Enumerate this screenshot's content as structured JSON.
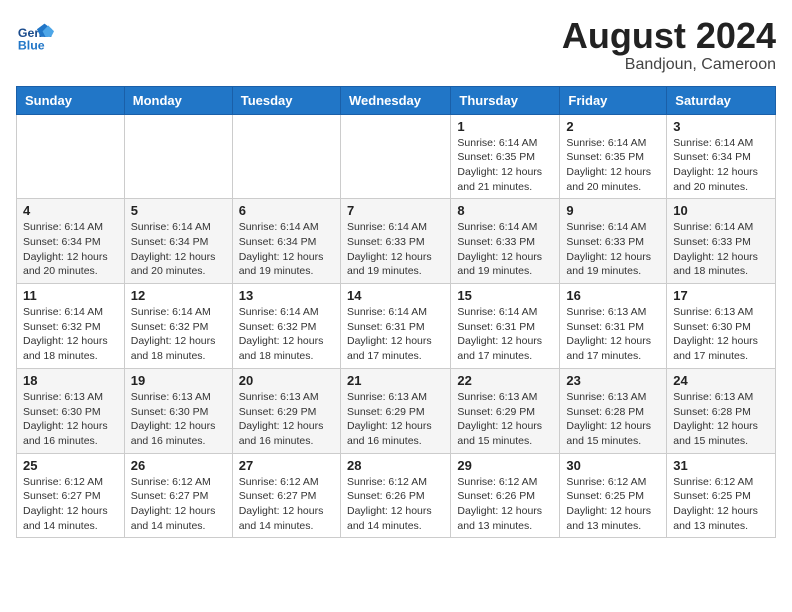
{
  "logo": {
    "line1": "General",
    "line2": "Blue"
  },
  "title": "August 2024",
  "location": "Bandjoun, Cameroon",
  "days_of_week": [
    "Sunday",
    "Monday",
    "Tuesday",
    "Wednesday",
    "Thursday",
    "Friday",
    "Saturday"
  ],
  "weeks": [
    [
      {
        "day": "",
        "detail": ""
      },
      {
        "day": "",
        "detail": ""
      },
      {
        "day": "",
        "detail": ""
      },
      {
        "day": "",
        "detail": ""
      },
      {
        "day": "1",
        "detail": "Sunrise: 6:14 AM\nSunset: 6:35 PM\nDaylight: 12 hours\nand 21 minutes."
      },
      {
        "day": "2",
        "detail": "Sunrise: 6:14 AM\nSunset: 6:35 PM\nDaylight: 12 hours\nand 20 minutes."
      },
      {
        "day": "3",
        "detail": "Sunrise: 6:14 AM\nSunset: 6:34 PM\nDaylight: 12 hours\nand 20 minutes."
      }
    ],
    [
      {
        "day": "4",
        "detail": "Sunrise: 6:14 AM\nSunset: 6:34 PM\nDaylight: 12 hours\nand 20 minutes."
      },
      {
        "day": "5",
        "detail": "Sunrise: 6:14 AM\nSunset: 6:34 PM\nDaylight: 12 hours\nand 20 minutes."
      },
      {
        "day": "6",
        "detail": "Sunrise: 6:14 AM\nSunset: 6:34 PM\nDaylight: 12 hours\nand 19 minutes."
      },
      {
        "day": "7",
        "detail": "Sunrise: 6:14 AM\nSunset: 6:33 PM\nDaylight: 12 hours\nand 19 minutes."
      },
      {
        "day": "8",
        "detail": "Sunrise: 6:14 AM\nSunset: 6:33 PM\nDaylight: 12 hours\nand 19 minutes."
      },
      {
        "day": "9",
        "detail": "Sunrise: 6:14 AM\nSunset: 6:33 PM\nDaylight: 12 hours\nand 19 minutes."
      },
      {
        "day": "10",
        "detail": "Sunrise: 6:14 AM\nSunset: 6:33 PM\nDaylight: 12 hours\nand 18 minutes."
      }
    ],
    [
      {
        "day": "11",
        "detail": "Sunrise: 6:14 AM\nSunset: 6:32 PM\nDaylight: 12 hours\nand 18 minutes."
      },
      {
        "day": "12",
        "detail": "Sunrise: 6:14 AM\nSunset: 6:32 PM\nDaylight: 12 hours\nand 18 minutes."
      },
      {
        "day": "13",
        "detail": "Sunrise: 6:14 AM\nSunset: 6:32 PM\nDaylight: 12 hours\nand 18 minutes."
      },
      {
        "day": "14",
        "detail": "Sunrise: 6:14 AM\nSunset: 6:31 PM\nDaylight: 12 hours\nand 17 minutes."
      },
      {
        "day": "15",
        "detail": "Sunrise: 6:14 AM\nSunset: 6:31 PM\nDaylight: 12 hours\nand 17 minutes."
      },
      {
        "day": "16",
        "detail": "Sunrise: 6:13 AM\nSunset: 6:31 PM\nDaylight: 12 hours\nand 17 minutes."
      },
      {
        "day": "17",
        "detail": "Sunrise: 6:13 AM\nSunset: 6:30 PM\nDaylight: 12 hours\nand 17 minutes."
      }
    ],
    [
      {
        "day": "18",
        "detail": "Sunrise: 6:13 AM\nSunset: 6:30 PM\nDaylight: 12 hours\nand 16 minutes."
      },
      {
        "day": "19",
        "detail": "Sunrise: 6:13 AM\nSunset: 6:30 PM\nDaylight: 12 hours\nand 16 minutes."
      },
      {
        "day": "20",
        "detail": "Sunrise: 6:13 AM\nSunset: 6:29 PM\nDaylight: 12 hours\nand 16 minutes."
      },
      {
        "day": "21",
        "detail": "Sunrise: 6:13 AM\nSunset: 6:29 PM\nDaylight: 12 hours\nand 16 minutes."
      },
      {
        "day": "22",
        "detail": "Sunrise: 6:13 AM\nSunset: 6:29 PM\nDaylight: 12 hours\nand 15 minutes."
      },
      {
        "day": "23",
        "detail": "Sunrise: 6:13 AM\nSunset: 6:28 PM\nDaylight: 12 hours\nand 15 minutes."
      },
      {
        "day": "24",
        "detail": "Sunrise: 6:13 AM\nSunset: 6:28 PM\nDaylight: 12 hours\nand 15 minutes."
      }
    ],
    [
      {
        "day": "25",
        "detail": "Sunrise: 6:12 AM\nSunset: 6:27 PM\nDaylight: 12 hours\nand 14 minutes."
      },
      {
        "day": "26",
        "detail": "Sunrise: 6:12 AM\nSunset: 6:27 PM\nDaylight: 12 hours\nand 14 minutes."
      },
      {
        "day": "27",
        "detail": "Sunrise: 6:12 AM\nSunset: 6:27 PM\nDaylight: 12 hours\nand 14 minutes."
      },
      {
        "day": "28",
        "detail": "Sunrise: 6:12 AM\nSunset: 6:26 PM\nDaylight: 12 hours\nand 14 minutes."
      },
      {
        "day": "29",
        "detail": "Sunrise: 6:12 AM\nSunset: 6:26 PM\nDaylight: 12 hours\nand 13 minutes."
      },
      {
        "day": "30",
        "detail": "Sunrise: 6:12 AM\nSunset: 6:25 PM\nDaylight: 12 hours\nand 13 minutes."
      },
      {
        "day": "31",
        "detail": "Sunrise: 6:12 AM\nSunset: 6:25 PM\nDaylight: 12 hours\nand 13 minutes."
      }
    ]
  ]
}
